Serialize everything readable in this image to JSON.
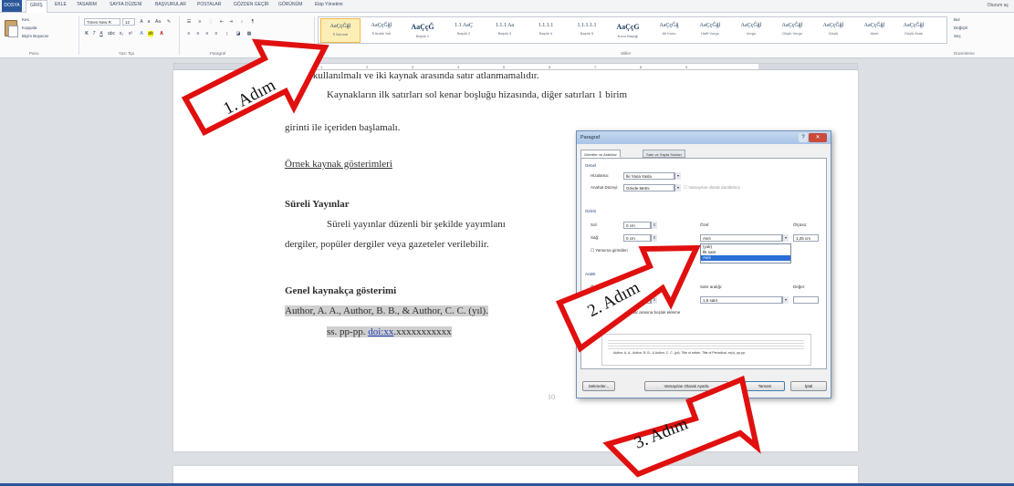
{
  "ribbon": {
    "tabs": [
      "DOSYA",
      "GİRİŞ",
      "EKLE",
      "TASARIM",
      "SAYFA DÜZENİ",
      "BAŞVURULAR",
      "POSTALAR",
      "GÖZDEN GEÇİR",
      "GÖRÜNÜM",
      "Ekip Yönetimi"
    ],
    "account": "Oturum aç",
    "clipboard": {
      "cut": "Kes",
      "copy": "Kopyala",
      "format_painter": "Biçim Boyacısı",
      "label": "Pano"
    },
    "font": {
      "name": "Times New R",
      "size": "12",
      "label": "Yazı Tipi"
    },
    "paragraph_label": "Paragraf",
    "styles_label": "Stiller",
    "styles": [
      {
        "preview": "AaÇçĞğl",
        "name": "¶ Normal"
      },
      {
        "preview": "AaÇçĞğl",
        "name": "¶ Aralık Yok"
      },
      {
        "preview": "AaÇçĞ",
        "name": "Başlık 1"
      },
      {
        "preview": "1.1 AaÇ",
        "name": "Başlık 2"
      },
      {
        "preview": "1.1.1 Aa",
        "name": "Başlık 3"
      },
      {
        "preview": "1.1.1.1",
        "name": "Başlık 4"
      },
      {
        "preview": "1.1.1.1.1",
        "name": "Başlık 5"
      },
      {
        "preview": "AaÇçG",
        "name": "Konu Başlığı"
      },
      {
        "preview": "AaÇçĞğ",
        "name": "Alt Konu"
      },
      {
        "preview": "AaÇçĞğl",
        "name": "Hafif Vurgu"
      },
      {
        "preview": "AaÇçĞğl",
        "name": "Vurgu"
      },
      {
        "preview": "AaÇçĞğl",
        "name": "Güçlü Vurgu"
      },
      {
        "preview": "AaÇçĞğl",
        "name": "Güçlü"
      },
      {
        "preview": "AaÇçĞğl",
        "name": "Alıntı"
      },
      {
        "preview": "AaÇçĞğl",
        "name": "Güçlü Alıntı"
      }
    ],
    "editing": {
      "find": "Bul",
      "replace": "Değiştir",
      "select": "Seç",
      "label": "Düzenleme"
    }
  },
  "document": {
    "line1": "aralığı kullanılmalı ve iki kaynak arasında satır atlanmamalıdır.",
    "line2": "Kaynakların ilk satırları sol kenar boşluğu hizasında, diğer satırları 1 birim",
    "line3": "girinti ile içeriden başlamalı.",
    "examples_heading": "Örnek kaynak gösterimleri",
    "section_heading": "Süreli Yayınlar",
    "para1": "Süreli yayınlar düzenli bir şekilde yayımlanı",
    "para2": "dergiler, popüler dergiler veya gazeteler verilebilir.",
    "general_heading": "Genel kaynakça gösterimi",
    "ref_line1": "Author, A. A., Author, B. B., & Author, C. C. (yıl).",
    "ref_line2_prefix": "ss. pp-pp. ",
    "ref_doi": "doi:xx",
    "ref_line2_suffix": ".xxxxxxxxxxx",
    "page_number": "10"
  },
  "dialog": {
    "title": "Paragraf",
    "tabs": [
      "Girintiler ve Aralıklar",
      "Satır ve Sayfa Sonları"
    ],
    "general": {
      "section": "Genel",
      "alignment_label": "Hizalama:",
      "alignment_value": "İki Yana Yasla",
      "outline_label": "Anahat Düzeyi:",
      "outline_value": "Gövde Metni",
      "collapsed_label": "Varsayılan olarak daraltılmış"
    },
    "indent": {
      "section": "Girinti",
      "left_label": "Sol:",
      "left_value": "0 cm",
      "right_label": "Sağ:",
      "right_value": "0 cm",
      "special_label": "Özel:",
      "special_value": "Asılı",
      "by_label": "Ölçüsü:",
      "by_value": "1,25 cm",
      "mirror_label": "Yansıma girintileri",
      "options": [
        "(yok)",
        "İlk satır",
        "Asılı"
      ]
    },
    "spacing": {
      "section": "Aralık",
      "before_label": "Önce:",
      "before_value": "0 nk",
      "after_label": "Sonra:",
      "after_value": "0 nk",
      "line_label": "Satır aralığı:",
      "line_value": "1,5 satır",
      "at_label": "Değer:",
      "nospace_label": "Aynı stildeki paragraflar arasına boşluk ekleme"
    },
    "preview_section": "Önizleme",
    "preview_text": "Author, A. A., Author, B. B., & Author, C. C. (yıl). Title of article. Title of Periodical, xx(x), pp-pp.",
    "buttons": {
      "tabs": "Sekmeler...",
      "default": "Varsayılan Olarak Ayarla",
      "ok": "Tamam",
      "cancel": "İptal"
    }
  },
  "callouts": {
    "step1": "1. Adım",
    "step2": "2. Adım",
    "step3": "3. Adım"
  },
  "colors": {
    "arrow_border": "#e0100f",
    "word_blue": "#2b579a",
    "selection": "#2a6fd6"
  }
}
